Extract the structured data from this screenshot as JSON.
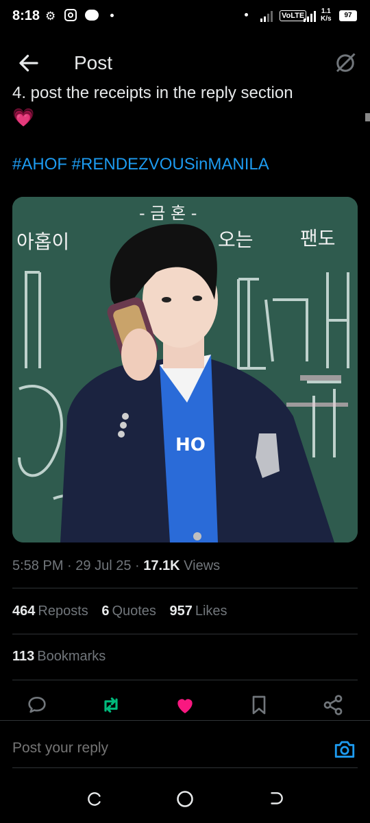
{
  "status_bar": {
    "time": "8:18",
    "network_label": "VoLTE",
    "speed_top": "1.1",
    "speed_bottom": "K/s",
    "battery": "97"
  },
  "header": {
    "title": "Post"
  },
  "post": {
    "text_line_1": "4. post the receipts in the reply section",
    "text_emoji": "💗",
    "hashtags": "#AHOF #RENDEZVOUSinMANILA",
    "chalkboard_text": [
      "- 금 혼 -",
      "아홉이",
      "오는",
      "팬도"
    ],
    "time": "5:58 PM",
    "date": "29 Jul 25",
    "views_count": "17.1K",
    "views_label": "Views"
  },
  "stats": {
    "reposts_count": "464",
    "reposts_label": "Reposts",
    "quotes_count": "6",
    "quotes_label": "Quotes",
    "likes_count": "957",
    "likes_label": "Likes",
    "bookmarks_count": "113",
    "bookmarks_label": "Bookmarks"
  },
  "actions": {
    "reply_icon": "reply-icon",
    "repost_icon": "repost-icon",
    "like_icon": "heart-icon",
    "bookmark_icon": "bookmark-icon",
    "share_icon": "share-icon"
  },
  "reply": {
    "placeholder": "Post your reply"
  },
  "colors": {
    "accent": "#1d9bf0",
    "repost_active": "#00ba7c",
    "like_active": "#f91880",
    "background": "#000000"
  }
}
